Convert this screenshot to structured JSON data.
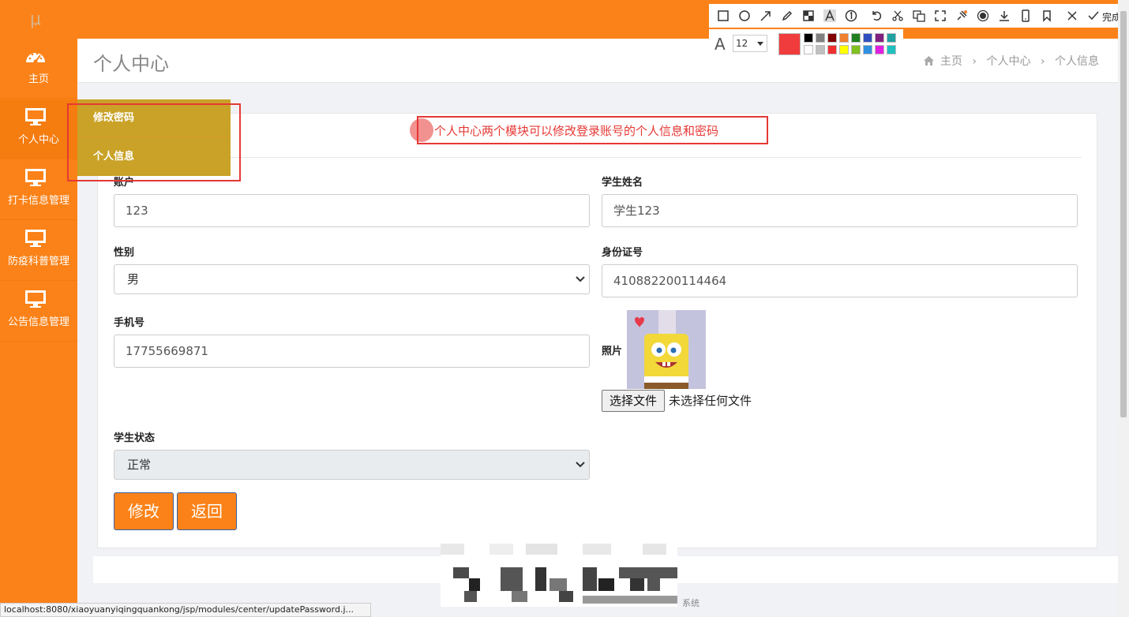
{
  "sidebar": {
    "logo": "μ",
    "items": [
      {
        "label": "主页",
        "icon": "dashboard-icon"
      },
      {
        "label": "个人中心",
        "icon": "monitor-icon"
      },
      {
        "label": "打卡信息管理",
        "icon": "monitor-icon"
      },
      {
        "label": "防疫科普管理",
        "icon": "monitor-icon"
      },
      {
        "label": "公告信息管理",
        "icon": "monitor-icon"
      }
    ],
    "submenu": [
      "修改密码",
      "个人信息"
    ]
  },
  "header": {
    "title": "个人中心",
    "breadcrumb": [
      "主页",
      "个人中心",
      "个人信息"
    ],
    "separator": "›"
  },
  "annotation": {
    "text": "个人中心两个模块可以修改登录账号的个人信息和密码"
  },
  "form": {
    "account_label": "账户",
    "account_value": "123",
    "name_label": "学生姓名",
    "name_value": "学生123",
    "gender_label": "性别",
    "gender_value": "男",
    "id_label": "身份证号",
    "id_value": "410882200114464",
    "phone_label": "手机号",
    "phone_value": "17755669871",
    "photo_label": "照片",
    "file_button": "选择文件",
    "file_status": "未选择任何文件",
    "status_label": "学生状态",
    "status_value": "正常",
    "modify_button": "修改",
    "back_button": "返回"
  },
  "toolbar": {
    "done_label": "完成",
    "font_size": "12",
    "current_color": "#f03c3c",
    "swatches": [
      "#000000",
      "#808080",
      "#800000",
      "#f08030",
      "#208020",
      "#3050c0",
      "#802080",
      "#20a0a0",
      "#ffffff",
      "#c0c0c0",
      "#f03030",
      "#ffff00",
      "#80c020",
      "#3090e0",
      "#e020e0",
      "#20c0c0"
    ]
  },
  "footer": {
    "text": "系统",
    "status_url": "localhost:8080/xiaoyuanyiqingquankong/jsp/modules/center/updatePassword.j..."
  },
  "colors": {
    "accent": "#fb8218",
    "submenu": "#c9a227",
    "annotation": "#e53935"
  }
}
